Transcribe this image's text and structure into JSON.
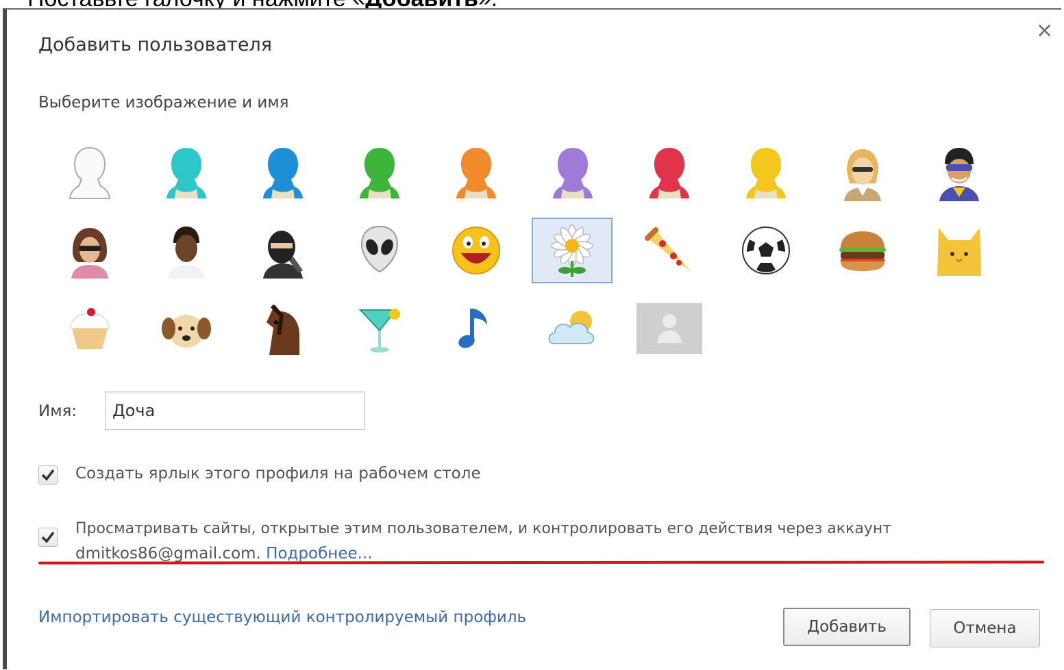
{
  "caption": {
    "text_before": "Поставьте галочку и нажмите «",
    "bold": "Добавить",
    "text_after": "»."
  },
  "dialog": {
    "title": "Добавить пользователя",
    "subtitle": "Выберите изображение и имя",
    "close_icon": "×",
    "avatars": [
      {
        "icon": "silhouette-white",
        "color": "#ffffff"
      },
      {
        "icon": "silhouette-cyan",
        "color": "#2ec7c9"
      },
      {
        "icon": "silhouette-blue",
        "color": "#1d8fd4"
      },
      {
        "icon": "silhouette-green",
        "color": "#3fb43a"
      },
      {
        "icon": "silhouette-orange",
        "color": "#f08a2a"
      },
      {
        "icon": "silhouette-purple",
        "color": "#a07ad8"
      },
      {
        "icon": "silhouette-red",
        "color": "#e0344a"
      },
      {
        "icon": "silhouette-yellow",
        "color": "#f3c71e"
      },
      {
        "icon": "businesswoman",
        "color": "#e8b65a"
      },
      {
        "icon": "superhero",
        "color": "#4a4fb0"
      },
      {
        "icon": "woman-sunglasses",
        "color": "#6b3b2a"
      },
      {
        "icon": "man",
        "color": "#6b4428"
      },
      {
        "icon": "ninja",
        "color": "#222222"
      },
      {
        "icon": "alien",
        "color": "#e4e4e4"
      },
      {
        "icon": "smiley",
        "color": "#f7c21c"
      },
      {
        "icon": "flower",
        "color": "#ffffff"
      },
      {
        "icon": "pizza",
        "color": "#f0a640"
      },
      {
        "icon": "soccer-ball",
        "color": "#ffffff"
      },
      {
        "icon": "burger",
        "color": "#c8823a"
      },
      {
        "icon": "cat",
        "color": "#f5c33a"
      },
      {
        "icon": "cupcake",
        "color": "#f6e2b6"
      },
      {
        "icon": "dog",
        "color": "#c68642"
      },
      {
        "icon": "horse",
        "color": "#6b3a1e"
      },
      {
        "icon": "cocktail",
        "color": "#4fd0c0"
      },
      {
        "icon": "music-note",
        "color": "#2a6cc0"
      },
      {
        "icon": "cloud-sun",
        "color": "#9cd6ee"
      },
      {
        "icon": "generic-person",
        "color": "#cfcfcf"
      }
    ],
    "selected_avatar": "flower",
    "name_label": "Имя:",
    "name_value": "Доча",
    "checkbox_shortcut": {
      "label": "Создать ярлык этого профиля на рабочем столе",
      "checked": true
    },
    "checkbox_supervised": {
      "label_line1": "Просматривать сайты, открытые этим пользователем, и контролировать его действия через аккаунт",
      "email": "dmitkos86@gmail.com.",
      "more_link": "Подробнее...",
      "checked": true
    },
    "highlight_color": "#d01818",
    "import_link": "Импортировать существующий контролируемый профиль",
    "add_button": "Добавить",
    "cancel_button": "Отмена"
  }
}
